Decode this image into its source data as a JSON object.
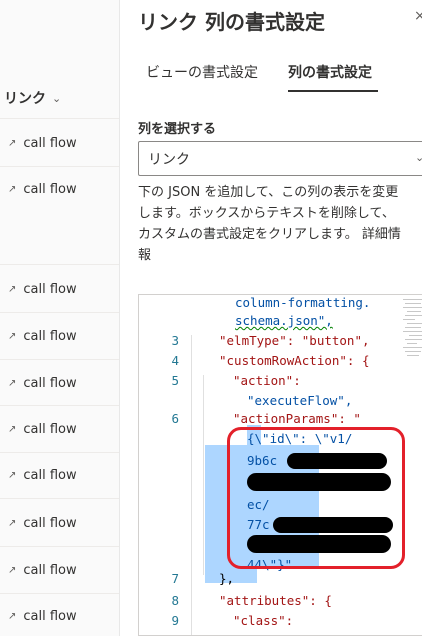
{
  "list": {
    "column_header": "リンク",
    "rows": [
      {
        "text": "call flow"
      },
      {
        "text": "call flow"
      },
      {
        "text": "call flow"
      },
      {
        "text": "call flow"
      },
      {
        "text": "call flow"
      },
      {
        "text": "call flow"
      },
      {
        "text": "call flow"
      },
      {
        "text": "call flow"
      },
      {
        "text": "call flow"
      },
      {
        "text": "call flow"
      }
    ]
  },
  "panel": {
    "title": "リンク 列の書式設定",
    "close_glyph": "×",
    "tabs": [
      {
        "label": "ビューの書式設定",
        "active": false
      },
      {
        "label": "列の書式設定",
        "active": true
      }
    ],
    "select_label": "列を選択する",
    "select_value": "リンク",
    "description_lines": [
      "下の JSON を追加して、この列の表示を変更",
      "します。ボックスからテキストを削除して、",
      "カスタムの書式設定をクリアします。 詳細情",
      "報"
    ]
  },
  "editor": {
    "lines": [
      {
        "n": "",
        "text": "column-formatting."
      },
      {
        "n": "",
        "text": "schema.json\","
      },
      {
        "n": "3",
        "text": "\"elmType\": \"button\","
      },
      {
        "n": "4",
        "text": "\"customRowAction\": {"
      },
      {
        "n": "5",
        "text": "\"action\":"
      },
      {
        "n": "",
        "text": "\"executeFlow\","
      },
      {
        "n": "6",
        "text": "\"actionParams\": \""
      },
      {
        "n": "",
        "text": "{\\\"id\\\": \\\"v1/"
      },
      {
        "n": "",
        "text": "9b6c"
      },
      {
        "n": "",
        "text": ""
      },
      {
        "n": "",
        "text": "ec/"
      },
      {
        "n": "",
        "text": "77c"
      },
      {
        "n": "",
        "text": ""
      },
      {
        "n": "",
        "text": "44\\\"}\""
      },
      {
        "n": "7",
        "text": "},"
      },
      {
        "n": "8",
        "text": "\"attributes\": {"
      },
      {
        "n": "9",
        "text": "\"class\":"
      }
    ]
  }
}
